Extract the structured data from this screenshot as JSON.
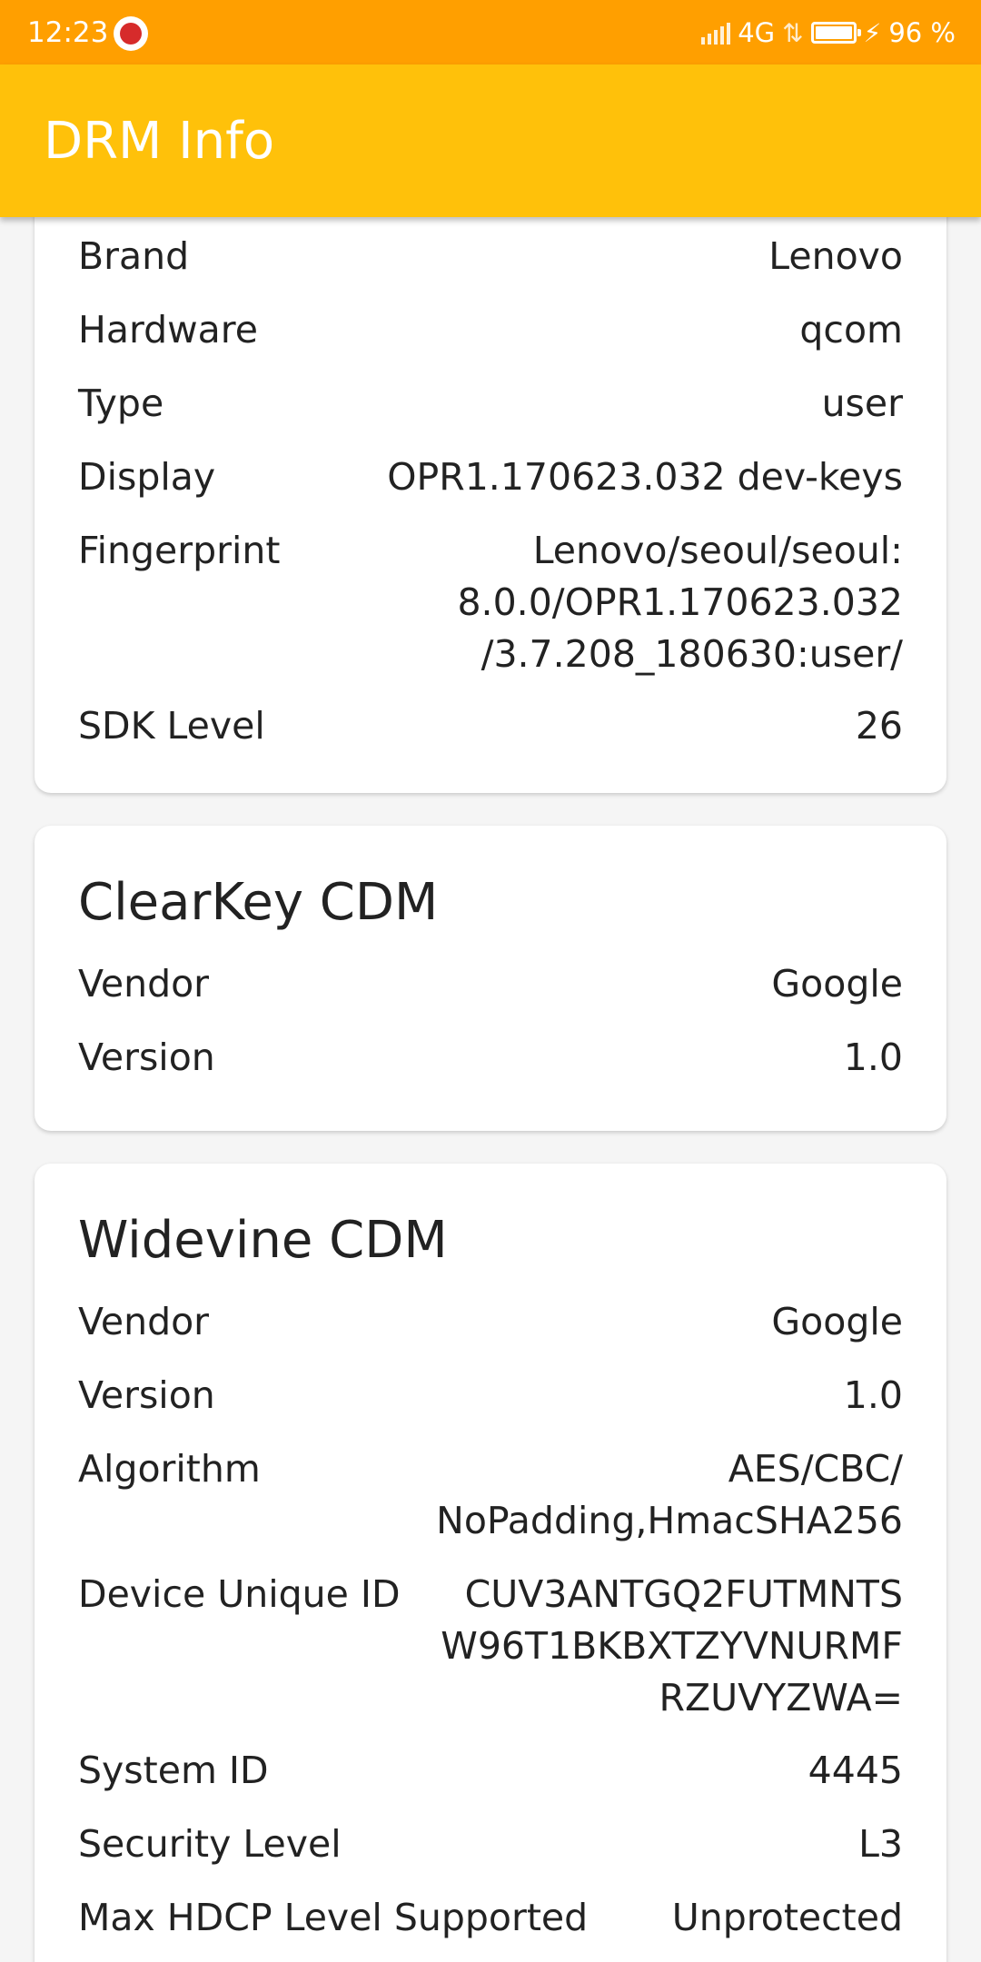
{
  "status_bar": {
    "time": "12:23",
    "network": "4G",
    "battery": "96 %",
    "battery_level": 0.96,
    "icons": [
      "app-notification-icon",
      "signal-icon",
      "data-arrows-icon",
      "battery-icon",
      "charging-bolt-icon"
    ]
  },
  "app_bar": {
    "title": "DRM Info",
    "color": "#ffc10a"
  },
  "device_card": {
    "rows": [
      {
        "label": "Brand",
        "value": "Lenovo"
      },
      {
        "label": "Hardware",
        "value": "qcom"
      },
      {
        "label": "Type",
        "value": "user"
      },
      {
        "label": "Display",
        "value": "OPR1.170623.032 dev-keys"
      },
      {
        "label": "Fingerprint",
        "value": "Lenovo/seoul/seoul:\n8.0.0/OPR1.170623.032\n/3.7.208_180630:user/"
      },
      {
        "label": "SDK Level",
        "value": "26"
      }
    ]
  },
  "clearkey_card": {
    "title": "ClearKey CDM",
    "rows": [
      {
        "label": "Vendor",
        "value": "Google"
      },
      {
        "label": "Version",
        "value": "1.0"
      }
    ]
  },
  "widevine_card": {
    "title": "Widevine CDM",
    "rows": [
      {
        "label": "Vendor",
        "value": "Google"
      },
      {
        "label": "Version",
        "value": "1.0"
      },
      {
        "label": "Algorithm",
        "value": "AES/CBC/\nNoPadding,HmacSHA256"
      },
      {
        "label": "Device Unique ID",
        "value": "CUV3ANTGQ2FUTMNTS\nW96T1BKBXTZYVNURMF\nRZUVYZWA="
      },
      {
        "label": "System ID",
        "value": "4445"
      },
      {
        "label": "Security Level",
        "value": "L3"
      },
      {
        "label": "Max HDCP Level Supported",
        "value": "Unprotected"
      }
    ]
  }
}
